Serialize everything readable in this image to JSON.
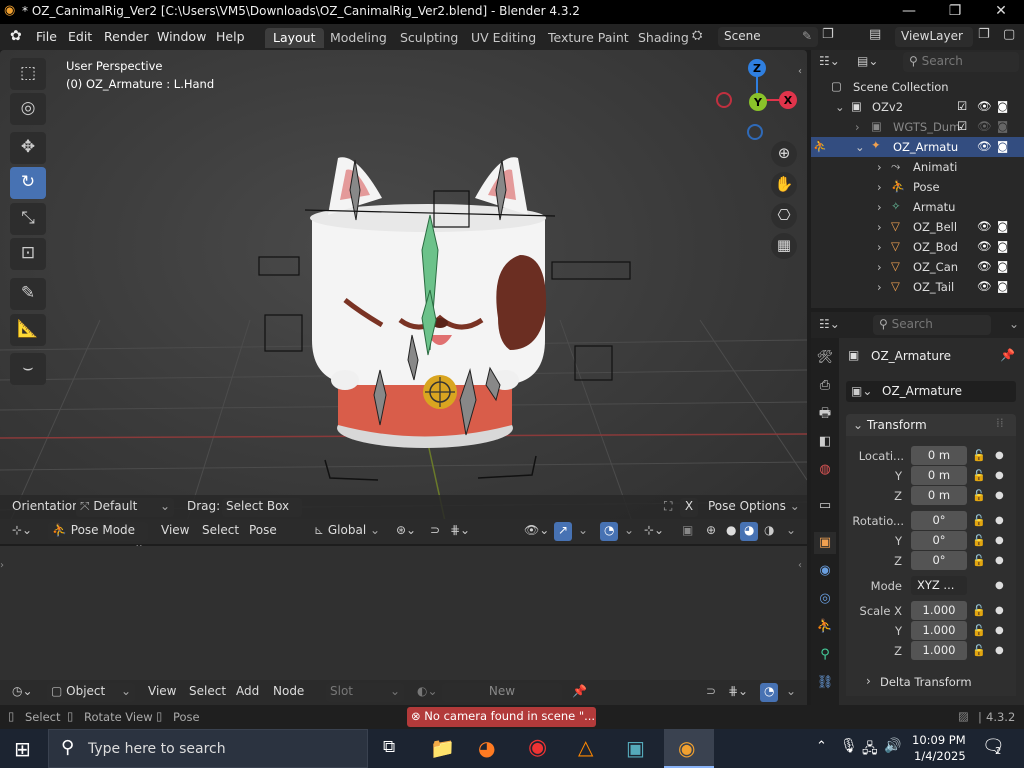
{
  "window": {
    "title": "* OZ_CanimalRig_Ver2 [C:\\Users\\VM5\\Downloads\\OZ_CanimalRig_Ver2.blend] - Blender 4.3.2",
    "minimize": "—",
    "maximize": "❐",
    "close": "✕"
  },
  "menu": {
    "items": [
      "File",
      "Edit",
      "Render",
      "Window",
      "Help"
    ]
  },
  "workspaces": [
    "Layout",
    "Modeling",
    "Sculpting",
    "UV Editing",
    "Texture Paint",
    "Shading"
  ],
  "scene": {
    "name": "Scene",
    "view_layer": "ViewLayer"
  },
  "viewport": {
    "perspective": "User Perspective",
    "active_object": "(0) OZ_Armature : L.Hand",
    "orientation_label": "Orientation:",
    "orientation_value": "Default",
    "drag_label": "Drag:",
    "drag_value": "Select Box",
    "pose_options": "Pose Options",
    "mode": "Pose Mode",
    "menus": [
      "View",
      "Select",
      "Pose"
    ],
    "transform_orientation": "Global",
    "gizmo_axes": {
      "x": "X",
      "y": "Y",
      "z": "Z"
    }
  },
  "node_editor": {
    "type": "Object",
    "menus": [
      "View",
      "Select",
      "Add",
      "Node"
    ],
    "slot": "Slot",
    "new_button": "New"
  },
  "outliner": {
    "search_placeholder": "Search",
    "root": "Scene Collection",
    "rows": [
      {
        "label": "OZv2",
        "type": "collection"
      },
      {
        "label": "WGTS_Dum",
        "type": "collection"
      },
      {
        "label": "OZ_Armatu",
        "type": "armature",
        "selected": true
      },
      {
        "label": "Animati",
        "type": "anim"
      },
      {
        "label": "Pose",
        "type": "pose"
      },
      {
        "label": "Armatu",
        "type": "armature-data"
      },
      {
        "label": "OZ_Bell",
        "type": "mesh"
      },
      {
        "label": "OZ_Bod",
        "type": "mesh"
      },
      {
        "label": "OZ_Can",
        "type": "mesh"
      },
      {
        "label": "OZ_Tail",
        "type": "mesh"
      }
    ]
  },
  "properties": {
    "search_placeholder": "Search",
    "object_name": "OZ_Armature",
    "object_field": "OZ_Armature",
    "transform_label": "Transform",
    "location_label": "Locati...",
    "location": [
      "0 m",
      "0 m",
      "0 m"
    ],
    "rotation_label": "Rotatio...",
    "rotation": [
      "0°",
      "0°",
      "0°"
    ],
    "mode_label": "Mode",
    "mode_value": "XYZ ...",
    "scale_label": "Scale X",
    "scale": [
      "1.000",
      "1.000",
      "1.000"
    ],
    "axis_y": "Y",
    "axis_z": "Z",
    "delta_transform": "Delta Transform"
  },
  "statusbar": {
    "select": "Select",
    "rotate_view": "Rotate View",
    "pose": "Pose",
    "warning": "No camera found in scene \"...",
    "version": "4.3.2"
  },
  "taskbar": {
    "search_placeholder": "Type here to search",
    "time": "10:09 PM",
    "date": "1/4/2025",
    "notifications": "2"
  },
  "colors": {
    "accent": "#4772b3",
    "selection": "#334d80",
    "x_axis": "#e0344b",
    "y_axis": "#8ac22a",
    "z_axis": "#2f7fe0",
    "warning": "#b23a3a"
  }
}
